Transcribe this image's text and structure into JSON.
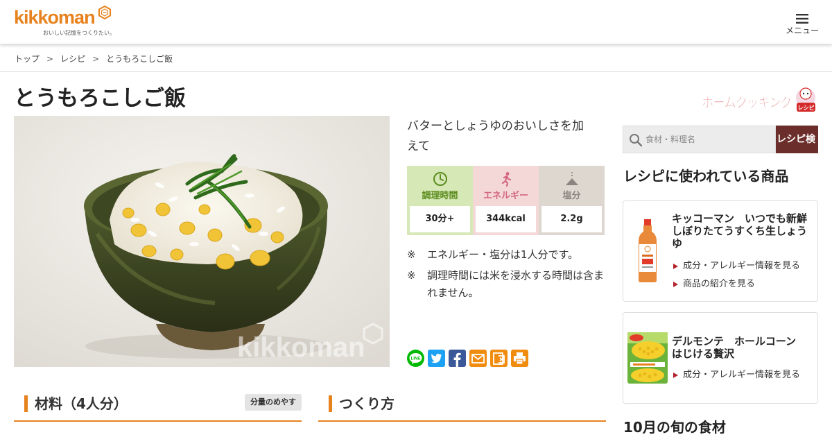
{
  "header": {
    "logo_text": "kikkoman",
    "logo_tagline": "おいしい記憶をつくりたい。",
    "menu_label": "メニュー"
  },
  "breadcrumb": {
    "items": [
      "トップ",
      "レシピ",
      "とうもろこしご飯"
    ],
    "separator": ">"
  },
  "recipe": {
    "title": "とうもろこしご飯",
    "description": "バターとしょうゆのおいしさを加えて",
    "info": {
      "time_label": "調理時間",
      "time_value": "30分+",
      "energy_label": "エネルギー",
      "energy_value": "344kcal",
      "salt_label": "塩分",
      "salt_value": "2.2g"
    },
    "notes": [
      {
        "mark": "※",
        "text": "エネルギー・塩分は1人分です。"
      },
      {
        "mark": "※",
        "text": "調理時間には米を浸水する時間は含まれません。"
      }
    ],
    "photo_watermark": "kikkoman"
  },
  "share": {
    "icons": [
      "line-icon",
      "twitter-icon",
      "facebook-icon",
      "mail-icon",
      "bookmark-icon",
      "print-icon"
    ],
    "line_text": "LINE"
  },
  "sections": {
    "ingredients_title": "材料（4人分）",
    "amount_button": "分量のめやす",
    "steps_title": "つくり方"
  },
  "sidebar": {
    "home_cooking_logo": "ホームクッキング",
    "home_cooking_badge": "レシピ",
    "search": {
      "placeholder": "食材・料理名",
      "button_label": "レシピ検"
    },
    "products_heading": "レシピに使われている商品",
    "products": [
      {
        "name": "キッコーマン　いつでも新鮮　しぼりたてうすくち生しょうゆ",
        "links": [
          "成分・アレルギー情報を見る",
          "商品の紹介を見る"
        ]
      },
      {
        "name": "デルモンテ　ホールコーン　はじける贅沢",
        "links": [
          "成分・アレルギー情報を見る"
        ]
      }
    ],
    "seasonal_heading": "10月の旬の食材"
  },
  "colors": {
    "brand_orange": "#e8821e",
    "time_bg": "#d6e8b6",
    "energy_bg": "#f4d8d8",
    "salt_bg": "#ddd7cf",
    "search_button": "#6b2e2a"
  }
}
